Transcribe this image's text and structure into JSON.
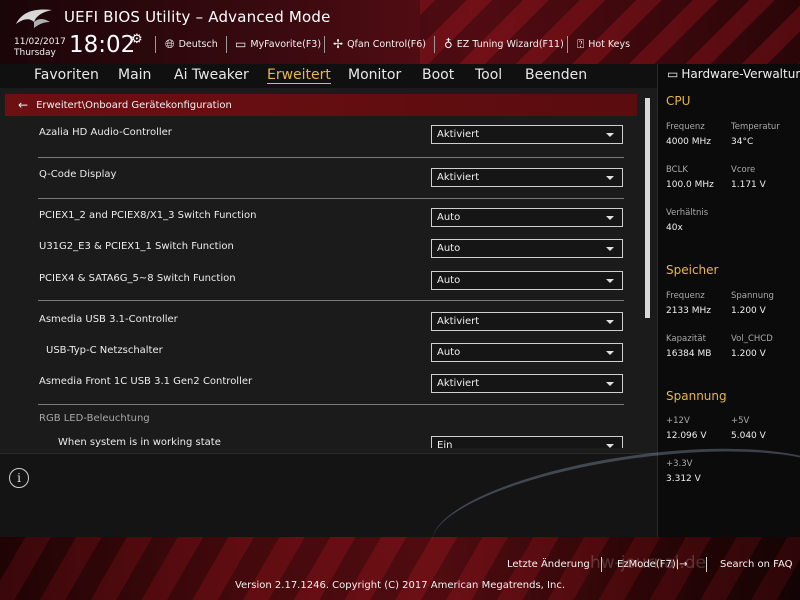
{
  "header": {
    "title": "UEFI BIOS Utility – Advanced Mode",
    "date": "11/02/2017",
    "day": "Thursday",
    "time": "18:02",
    "tools": {
      "language": "Deutsch",
      "favorite": "MyFavorite(F3)",
      "qfan": "Qfan Control(F6)",
      "ez_tuning": "EZ Tuning Wizard(F11)",
      "hotkeys": "Hot Keys"
    }
  },
  "tabs": [
    "Favoriten",
    "Main",
    "Ai Tweaker",
    "Erweitert",
    "Monitor",
    "Boot",
    "Tool",
    "Beenden"
  ],
  "active_tab": "Erweitert",
  "breadcrumb": "Erweitert\\Onboard Gerätekonfiguration",
  "settings": [
    {
      "label": "Azalia HD Audio-Controller",
      "value": "Aktiviert"
    },
    {
      "label": "Q-Code Display",
      "value": "Aktiviert"
    },
    {
      "label": "PCIEX1_2 and PCIEX8/X1_3 Switch Function",
      "value": "Auto"
    },
    {
      "label": "U31G2_E3 & PCIEX1_1 Switch Function",
      "value": "Auto"
    },
    {
      "label": "PCIEX4 & SATA6G_5~8 Switch Function",
      "value": "Auto"
    },
    {
      "label": "Asmedia USB 3.1-Controller",
      "value": "Aktiviert"
    },
    {
      "label": "USB-Typ-C Netzschalter",
      "value": "Auto"
    },
    {
      "label": "Asmedia Front 1C USB 3.1 Gen2 Controller",
      "value": "Aktiviert"
    },
    {
      "label": "When system is in working state",
      "value": "Ein"
    }
  ],
  "section_rgb": "RGB LED-Beleuchtung",
  "hardware_monitor": {
    "title": "Hardware-Verwaltung",
    "cpu": {
      "heading": "CPU",
      "frequency_label": "Frequenz",
      "frequency": "4000 MHz",
      "temperature_label": "Temperatur",
      "temperature": "34°C",
      "bclk_label": "BCLK",
      "bclk": "100.0 MHz",
      "vcore_label": "Vcore",
      "vcore": "1.171 V",
      "ratio_label": "Verhältnis",
      "ratio": "40x"
    },
    "memory": {
      "heading": "Speicher",
      "frequency_label": "Frequenz",
      "frequency": "2133 MHz",
      "voltage_label": "Spannung",
      "voltage": "1.200 V",
      "capacity_label": "Kapazität",
      "capacity": "16384 MB",
      "vol_chcd_label": "Vol_CHCD",
      "vol_chcd": "1.200 V"
    },
    "voltage": {
      "heading": "Spannung",
      "v12_label": "+12V",
      "v12": "12.096 V",
      "v5_label": "+5V",
      "v5": "5.040 V",
      "v33_label": "+3.3V",
      "v33": "3.312 V"
    }
  },
  "footer": {
    "last_change": "Letzte Änderung",
    "ezmode": "EzMode(F7)|→",
    "search": "Search on FAQ",
    "version": "Version 2.17.1246. Copyright (C) 2017 American Megatrends, Inc.",
    "watermark": "hw-journal.de"
  },
  "colors": {
    "accent_gold": "#e8b64a",
    "rog_red": "#6e0f12",
    "panel_bg": "#1b1b1b",
    "hw_bg": "#0b0b0b"
  },
  "icons": {
    "logo": "rog-logo",
    "gear": "gear-icon",
    "globe": "globe-icon",
    "favorite": "monitor-star-icon",
    "qfan": "fan-icon",
    "ez_tuning": "lightbulb-icon",
    "hotkeys": "question-icon",
    "back": "back-arrow-icon",
    "info": "info-icon",
    "hw": "monitor-icon"
  }
}
